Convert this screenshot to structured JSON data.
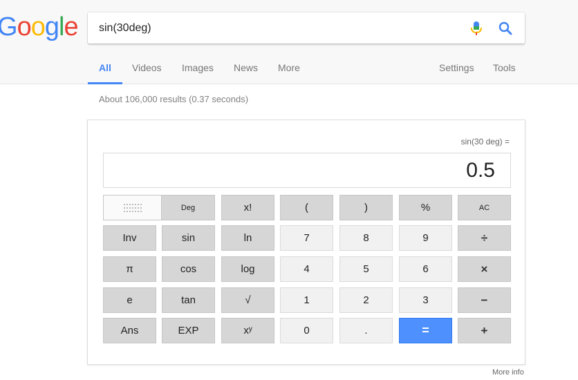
{
  "logo": {
    "letters": [
      "G",
      "o",
      "o",
      "g",
      "l",
      "e"
    ],
    "colors": [
      "#4285f4",
      "#ea4335",
      "#fbbc05",
      "#4285f4",
      "#34a853",
      "#ea4335"
    ]
  },
  "search": {
    "value": "sin(30deg)"
  },
  "icons": {
    "mic": "mic-icon",
    "search": "search-icon",
    "grid": "dotted-grid-icon"
  },
  "tabs": {
    "all": "All",
    "videos": "Videos",
    "images": "Images",
    "news": "News",
    "more": "More",
    "settings": "Settings",
    "tools": "Tools"
  },
  "stats": "About 106,000 results (0.37 seconds)",
  "calculator": {
    "expression": "sin(30 deg) =",
    "result": "0.5",
    "deg_label": "Deg",
    "keys": {
      "fact": "x!",
      "lparen": "(",
      "rparen": ")",
      "percent": "%",
      "ac": "AC",
      "inv": "Inv",
      "sin": "sin",
      "ln": "ln",
      "seven": "7",
      "eight": "8",
      "nine": "9",
      "divide": "÷",
      "pi": "π",
      "cos": "cos",
      "log": "log",
      "four": "4",
      "five": "5",
      "six": "6",
      "multiply": "×",
      "e": "e",
      "tan": "tan",
      "sqrt": "√",
      "one": "1",
      "two": "2",
      "three": "3",
      "minus": "−",
      "ans": "Ans",
      "exp": "EXP",
      "pow": "xʸ",
      "zero": "0",
      "dot": ".",
      "equals": "=",
      "plus": "+"
    },
    "accent_color": "#4d90fe"
  },
  "more_info": "More info"
}
